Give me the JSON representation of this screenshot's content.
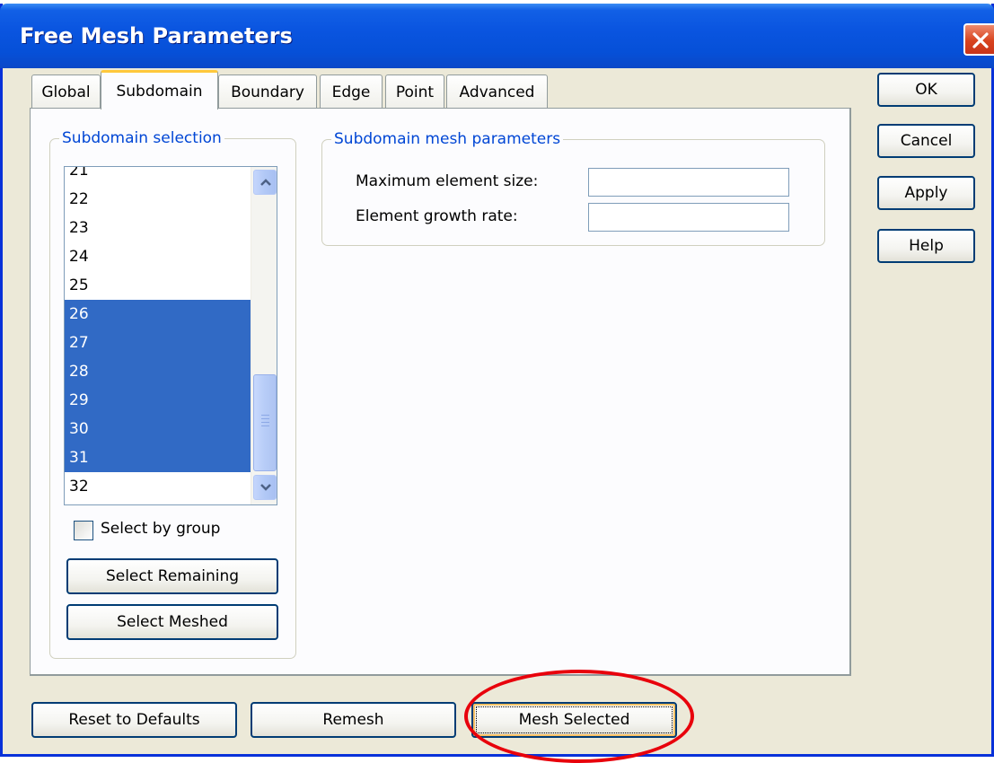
{
  "window": {
    "title": "Free Mesh Parameters"
  },
  "tabs": [
    {
      "label": "Global",
      "active": false
    },
    {
      "label": "Subdomain",
      "active": true
    },
    {
      "label": "Boundary",
      "active": false
    },
    {
      "label": "Edge",
      "active": false
    },
    {
      "label": "Point",
      "active": false
    },
    {
      "label": "Advanced",
      "active": false
    }
  ],
  "subdomain_selection": {
    "legend": "Subdomain selection",
    "items": [
      {
        "label": "21",
        "selected": false
      },
      {
        "label": "22",
        "selected": false
      },
      {
        "label": "23",
        "selected": false
      },
      {
        "label": "24",
        "selected": false
      },
      {
        "label": "25",
        "selected": false
      },
      {
        "label": "26",
        "selected": true
      },
      {
        "label": "27",
        "selected": true
      },
      {
        "label": "28",
        "selected": true
      },
      {
        "label": "29",
        "selected": true
      },
      {
        "label": "30",
        "selected": true
      },
      {
        "label": "31",
        "selected": true
      },
      {
        "label": "32",
        "selected": false
      }
    ],
    "select_by_group_label": "Select by group",
    "select_by_group_checked": false,
    "select_remaining_label": "Select Remaining",
    "select_meshed_label": "Select Meshed"
  },
  "mesh_parameters": {
    "legend": "Subdomain mesh parameters",
    "max_element_size_label": "Maximum element size:",
    "max_element_size_value": "",
    "growth_rate_label": "Element growth rate:",
    "growth_rate_value": ""
  },
  "side_buttons": {
    "ok": "OK",
    "cancel": "Cancel",
    "apply": "Apply",
    "help": "Help"
  },
  "bottom_buttons": {
    "reset": "Reset to Defaults",
    "remesh": "Remesh",
    "mesh_selected": "Mesh Selected"
  },
  "icons": {
    "close": "close-icon",
    "scroll_up": "chevron-up-icon",
    "scroll_down": "chevron-down-icon"
  },
  "colors": {
    "titlebar": "#0a55e0",
    "selection": "#316ac5",
    "legend_text": "#0046d5",
    "annotation": "#e8000b"
  }
}
